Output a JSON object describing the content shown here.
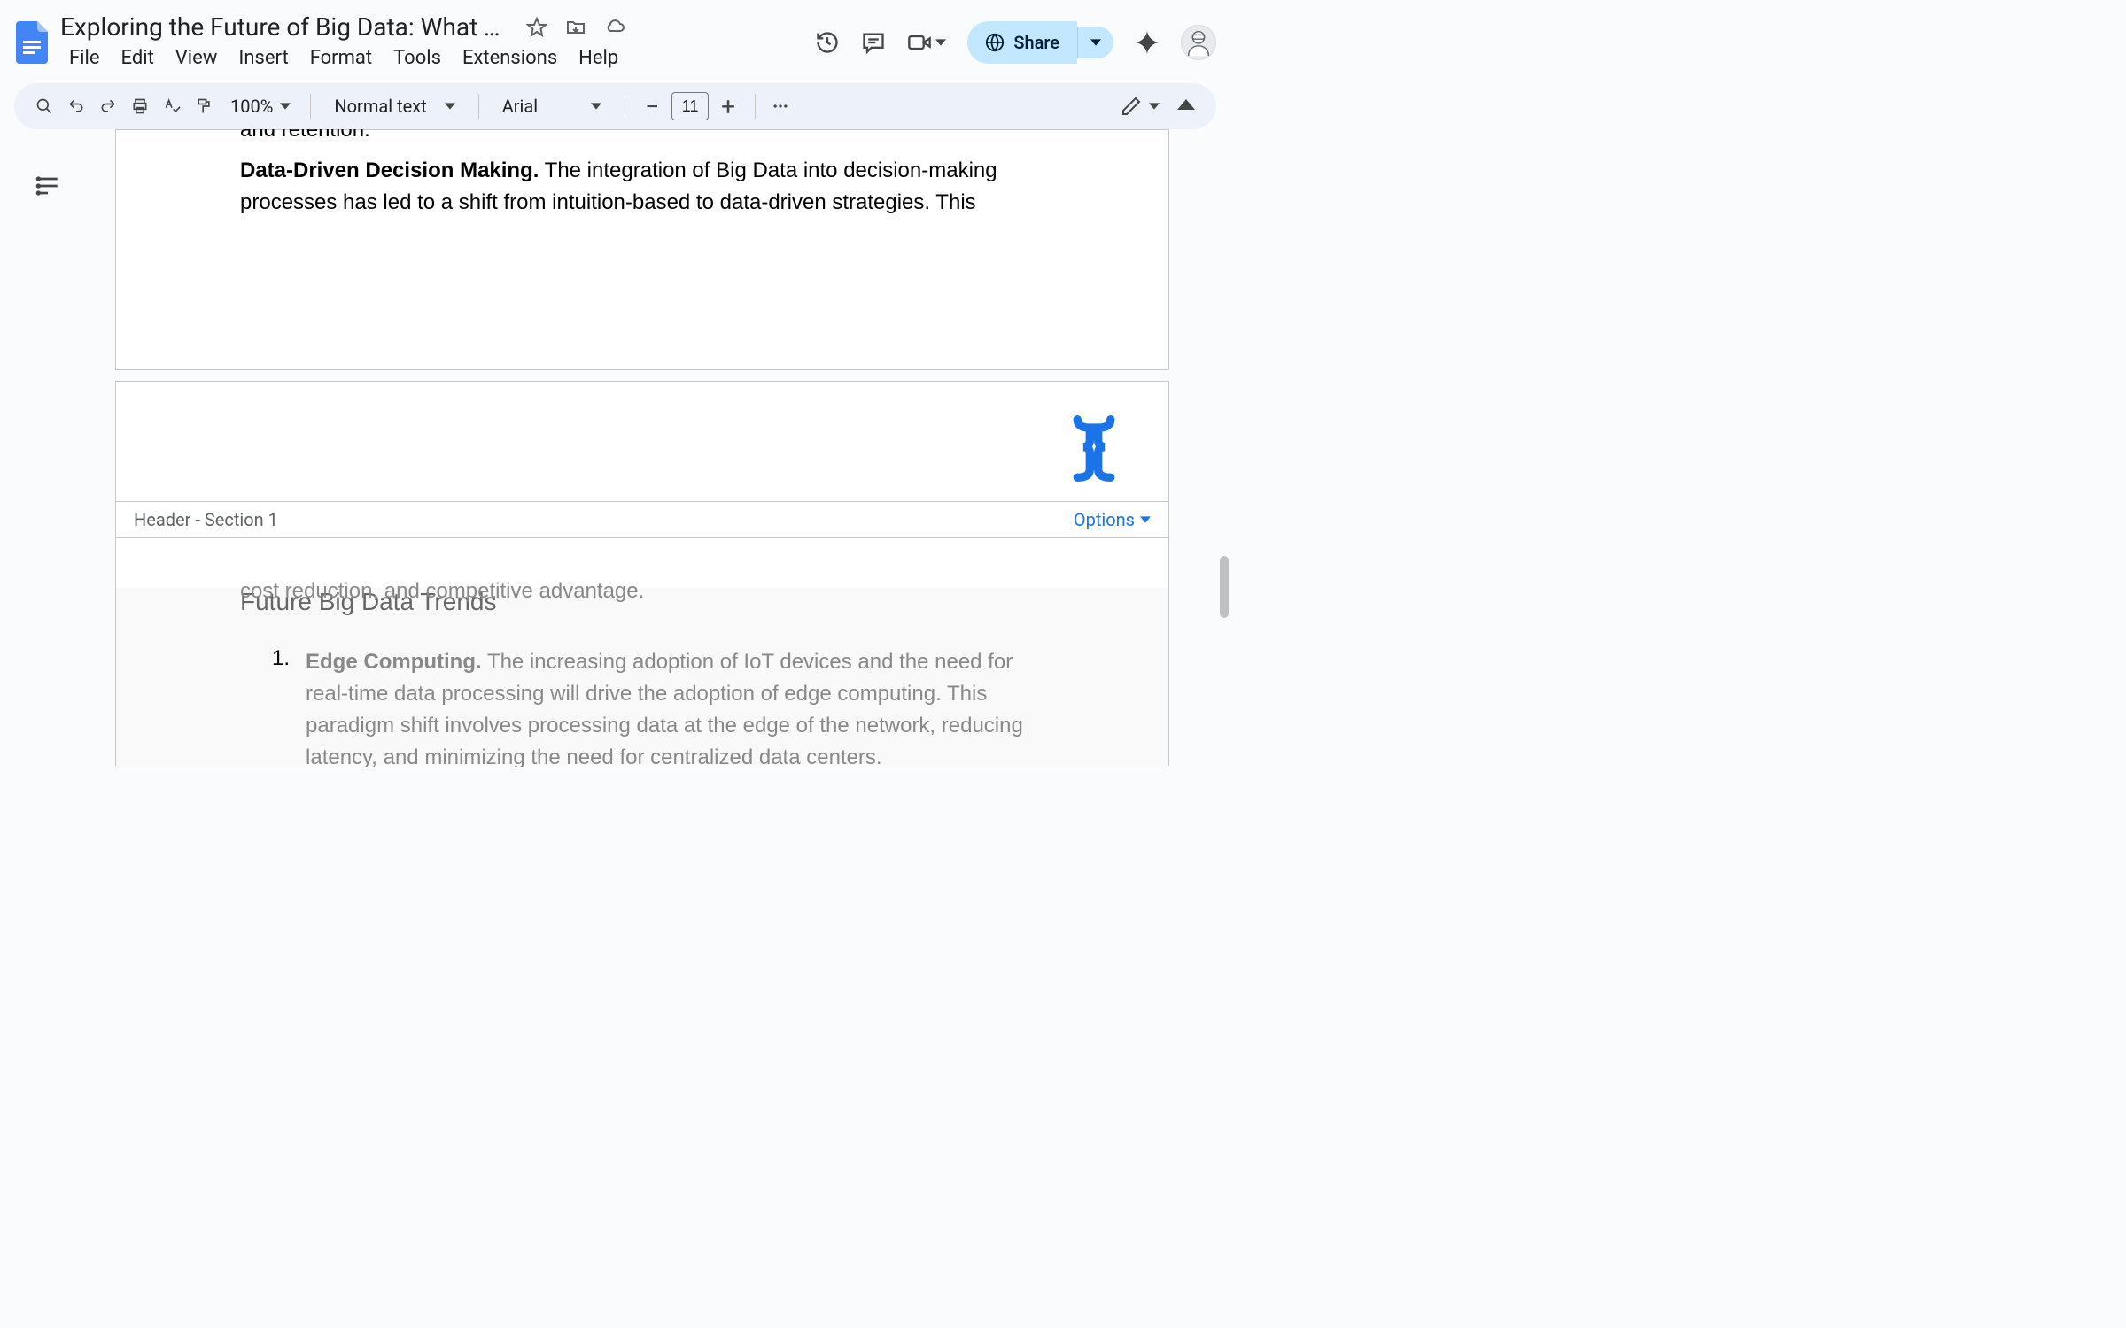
{
  "header": {
    "doc_title": "Exploring the Future of Big Data: What Tec…",
    "menus": [
      "File",
      "Edit",
      "View",
      "Insert",
      "Format",
      "Tools",
      "Extensions",
      "Help"
    ],
    "share_label": "Share"
  },
  "toolbar": {
    "zoom": "100%",
    "style": "Normal text",
    "font": "Arial",
    "font_size": "11"
  },
  "document": {
    "page1": {
      "clipped_line": "and retention.",
      "para2_bold": "Data-Driven Decision Making.",
      "para2_text": " The integration of Big Data into decision-making processes has led to a shift from intuition-based to data-driven strategies. This"
    },
    "page2": {
      "header_label": "Header - Section 1",
      "options_label": "Options",
      "clipped_body": "cost reduction, and competitive advantage.",
      "heading": "Future Big Data Trends",
      "list_num": "1.",
      "list_bold": "Edge Computing.",
      "list_text": " The increasing adoption of IoT devices and the need for real-time data processing will drive the adoption of edge computing. This paradigm shift involves processing data at the edge of the network, reducing latency, and minimizing the need for centralized data centers."
    }
  }
}
